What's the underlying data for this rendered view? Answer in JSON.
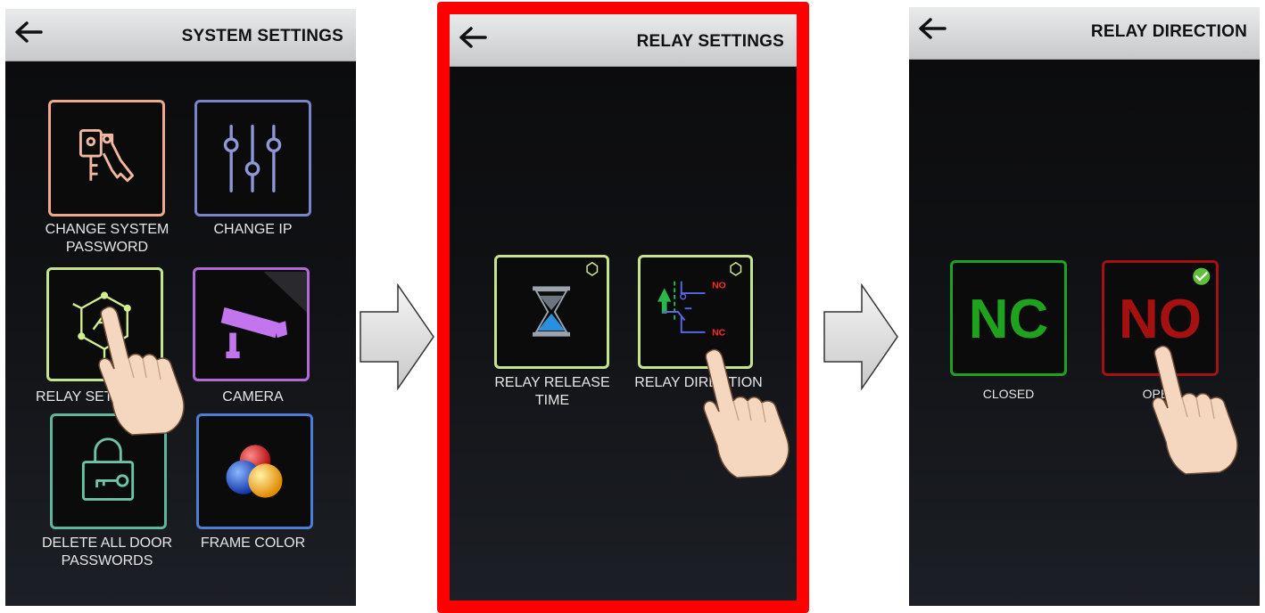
{
  "screens": [
    {
      "title": "SYSTEM SETTINGS",
      "tiles": [
        {
          "label": "CHANGE SYSTEM\nPASSWORD",
          "color": "#f0a88a",
          "icon": "keys-icon"
        },
        {
          "label": "CHANGE IP",
          "color": "#7a84c8",
          "icon": "sliders-icon"
        },
        {
          "label": "RELAY SET",
          "color": "#c6e58a",
          "icon": "relay-chip-icon"
        },
        {
          "label": "CAMERA",
          "color": "#b06ad8",
          "icon": "camera-icon"
        },
        {
          "label": "DELETE ALL DOOR\nPASSWORDS",
          "color": "#5fb79a",
          "icon": "lock-key-icon"
        },
        {
          "label": "FRAME COLOR",
          "color": "#4c7ed8",
          "icon": "color-balls-icon"
        }
      ]
    },
    {
      "title": "RELAY SETTINGS",
      "highlight_color": "#ff0000",
      "tiles": [
        {
          "label": "RELAY RELEASE\nTIME",
          "color": "#c6e58a",
          "icon": "hourglass-icon"
        },
        {
          "label": "RELAY DIRECTION",
          "color": "#c6e58a",
          "icon": "relay-diagram-icon",
          "no_text": "NO",
          "nc_text": "NC"
        }
      ]
    },
    {
      "title": "RELAY DIRECTION",
      "tiles": [
        {
          "label": "CLOSED",
          "text": "NC",
          "color": "#1fa31f"
        },
        {
          "label": "OPEN",
          "text": "NO",
          "color": "#a51010"
        }
      ]
    }
  ],
  "icons": {
    "back": "back-arrow-icon",
    "next": "right-arrow-icon",
    "hand": "pointing-hand-icon",
    "check": "check-badge-icon"
  }
}
